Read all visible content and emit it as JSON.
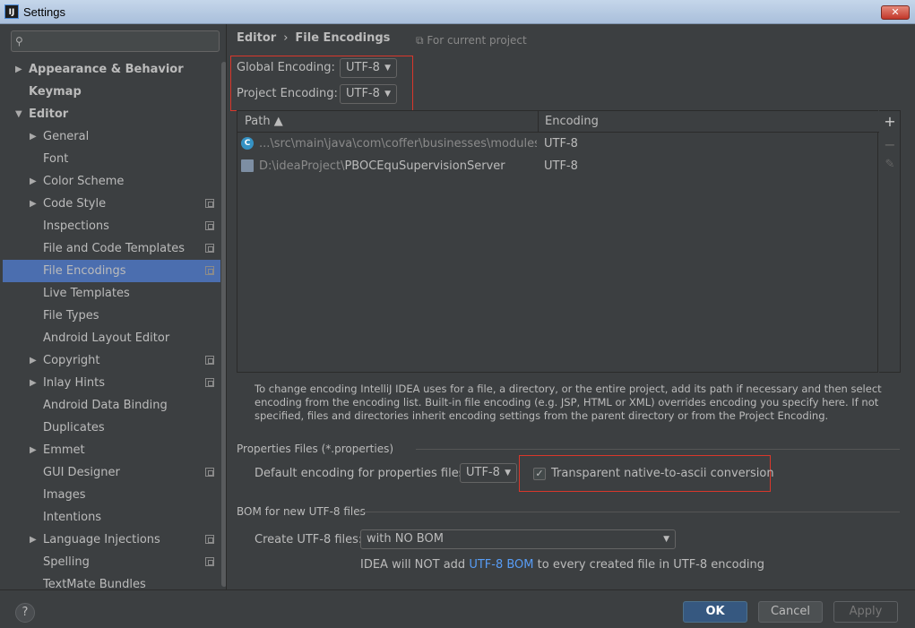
{
  "window": {
    "title": "Settings",
    "app_icon": "IJ",
    "close_label": "✕"
  },
  "search": {
    "placeholder": ""
  },
  "sidebar": {
    "items": [
      {
        "label": "Appearance & Behavior",
        "level": 0,
        "arrow": "▶",
        "bold": true
      },
      {
        "label": "Keymap",
        "level": 0,
        "arrow": "",
        "bold": true
      },
      {
        "label": "Editor",
        "level": 0,
        "arrow": "▼",
        "bold": true
      },
      {
        "label": "General",
        "level": 1,
        "arrow": "▶"
      },
      {
        "label": "Font",
        "level": 1,
        "arrow": ""
      },
      {
        "label": "Color Scheme",
        "level": 1,
        "arrow": "▶"
      },
      {
        "label": "Code Style",
        "level": 1,
        "arrow": "▶",
        "copy": true
      },
      {
        "label": "Inspections",
        "level": 1,
        "arrow": "",
        "copy": true
      },
      {
        "label": "File and Code Templates",
        "level": 1,
        "arrow": "",
        "copy": true
      },
      {
        "label": "File Encodings",
        "level": 1,
        "arrow": "",
        "copy": true,
        "selected": true
      },
      {
        "label": "Live Templates",
        "level": 1,
        "arrow": ""
      },
      {
        "label": "File Types",
        "level": 1,
        "arrow": ""
      },
      {
        "label": "Android Layout Editor",
        "level": 1,
        "arrow": ""
      },
      {
        "label": "Copyright",
        "level": 1,
        "arrow": "▶",
        "copy": true
      },
      {
        "label": "Inlay Hints",
        "level": 1,
        "arrow": "▶",
        "copy": true
      },
      {
        "label": "Android Data Binding",
        "level": 1,
        "arrow": ""
      },
      {
        "label": "Duplicates",
        "level": 1,
        "arrow": ""
      },
      {
        "label": "Emmet",
        "level": 1,
        "arrow": "▶"
      },
      {
        "label": "GUI Designer",
        "level": 1,
        "arrow": "",
        "copy": true
      },
      {
        "label": "Images",
        "level": 1,
        "arrow": ""
      },
      {
        "label": "Intentions",
        "level": 1,
        "arrow": ""
      },
      {
        "label": "Language Injections",
        "level": 1,
        "arrow": "▶",
        "copy": true
      },
      {
        "label": "Spelling",
        "level": 1,
        "arrow": "",
        "copy": true
      },
      {
        "label": "TextMate Bundles",
        "level": 1,
        "arrow": ""
      }
    ]
  },
  "breadcrumb": {
    "parent": "Editor",
    "separator": "›",
    "current": "File Encodings"
  },
  "for_current_project": "For current project",
  "global_encoding": {
    "label": "Global Encoding:",
    "value": "UTF-8"
  },
  "project_encoding": {
    "label": "Project Encoding:",
    "value": "UTF-8"
  },
  "table": {
    "col_path": "Path ▲",
    "col_encoding": "Encoding",
    "rows": [
      {
        "path_dim": "...\\src\\main\\java\\com\\coffer\\businesses\\modules\\gzh\\",
        "path_strong": "",
        "encoding": "UTF-8",
        "icon": "C"
      },
      {
        "path_dim": "D:\\ideaProject\\",
        "path_strong": "PBOCEquSupervisionServer",
        "encoding": "UTF-8",
        "icon": ""
      }
    ],
    "toolbar": {
      "add": "+",
      "remove": "−",
      "edit": "✎"
    }
  },
  "description": "To change encoding IntelliJ IDEA uses for a file, a directory, or the entire project, add its path if necessary and then select encoding from the encoding list. Built-in file encoding (e.g. JSP, HTML or XML) overrides encoding you specify here. If not specified, files and directories inherit encoding settings from the parent directory or from the Project Encoding.",
  "properties": {
    "section_title": "Properties Files (*.properties)",
    "default_label": "Default encoding for properties files:",
    "default_value": "UTF-8",
    "transparent_label": "Transparent native-to-ascii conversion",
    "transparent_checked": "✓"
  },
  "bom": {
    "section_title": "BOM for new UTF-8 files",
    "create_label": "Create UTF-8 files:",
    "create_value": "with NO BOM",
    "note_before": "IDEA will NOT add ",
    "note_link": "UTF-8 BOM",
    "note_after": " to every created file in UTF-8 encoding"
  },
  "footer": {
    "help": "?",
    "ok": "OK",
    "cancel": "Cancel",
    "apply": "Apply"
  },
  "colors": {
    "background": "#3c3f41",
    "selection": "#4b6eaf",
    "highlight_box": "#d9372b",
    "link": "#589df6",
    "ok_button": "#365880"
  }
}
